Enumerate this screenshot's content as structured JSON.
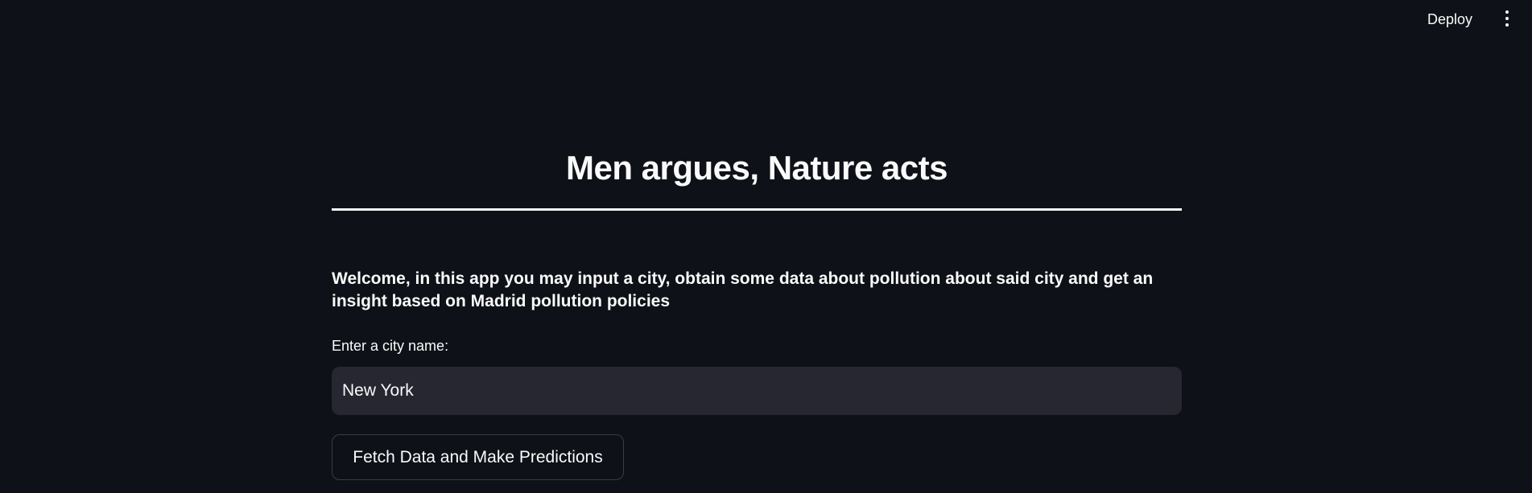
{
  "header": {
    "deploy_label": "Deploy",
    "menu_icon": "more-vertical-icon"
  },
  "main": {
    "title": "Men argues, Nature acts",
    "welcome_text": "Welcome, in this app you may input a city, obtain some data about pollution about said city and get an insight based on Madrid pollution policies",
    "city_field": {
      "label": "Enter a city name:",
      "value": "New York"
    },
    "fetch_button_label": "Fetch Data and Make Predictions"
  },
  "colors": {
    "background": "#0e1117",
    "input_background": "#262730",
    "text": "#fafafa",
    "button_border": "#3a3d47"
  }
}
